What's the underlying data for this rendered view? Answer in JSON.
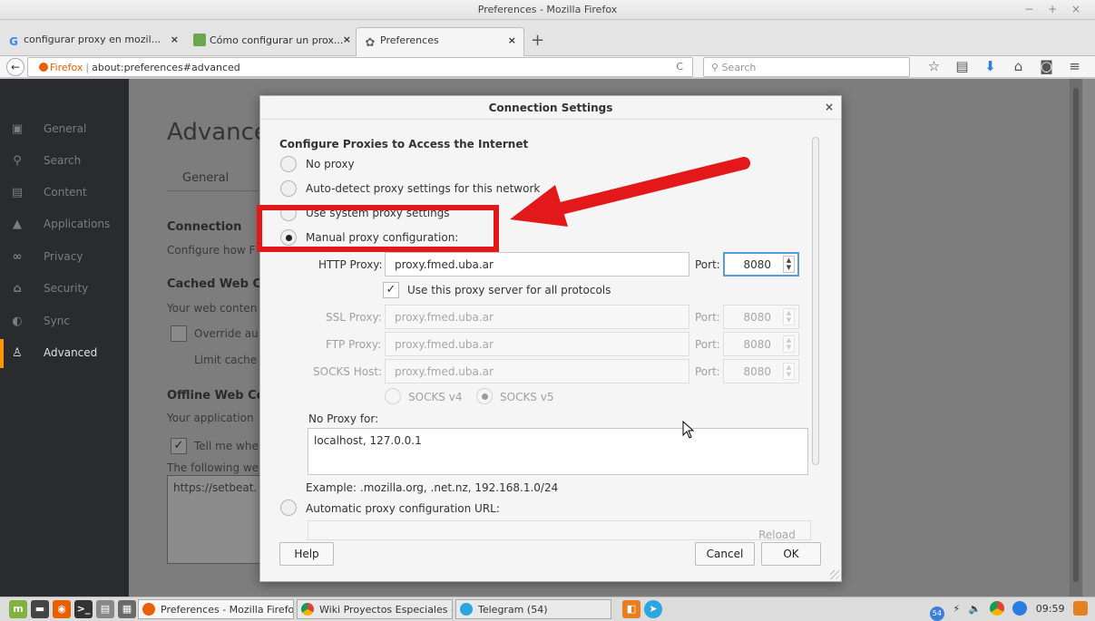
{
  "window": {
    "title": "Preferences - Mozilla Firefox",
    "controls": "− + ×"
  },
  "tabs": [
    {
      "label": "configurar proxy en mozil...",
      "close": "×",
      "icon": "google-icon"
    },
    {
      "label": "Cómo configurar un prox...",
      "close": "×",
      "icon": "site-favicon"
    },
    {
      "label": "Preferences",
      "close": "×",
      "icon": "gear-icon"
    }
  ],
  "new_tab_label": "+",
  "navbar": {
    "back": "←",
    "identity": "Firefox",
    "url": "about:preferences#advanced",
    "reload": "C",
    "search_placeholder": "Search",
    "icons": [
      "star-icon",
      "bookmarks-icon",
      "download-icon",
      "home-icon",
      "pocket-icon",
      "menu-icon"
    ]
  },
  "sidebar": {
    "items": [
      {
        "label": "General",
        "icon": "general-icon"
      },
      {
        "label": "Search",
        "icon": "search-icon"
      },
      {
        "label": "Content",
        "icon": "content-icon"
      },
      {
        "label": "Applications",
        "icon": "applications-icon"
      },
      {
        "label": "Privacy",
        "icon": "privacy-icon"
      },
      {
        "label": "Security",
        "icon": "security-icon"
      },
      {
        "label": "Sync",
        "icon": "sync-icon"
      },
      {
        "label": "Advanced",
        "icon": "advanced-icon",
        "active": true
      }
    ]
  },
  "prefs": {
    "title": "Advance",
    "subtab": "General",
    "connection_heading": "Connection",
    "connection_text": "Configure how F",
    "cached_heading": "Cached Web Co",
    "cached_text": "Your web conten",
    "override_label": "Override au",
    "limit_label": "Limit cache",
    "offline_heading": "Offline Web Co",
    "offline_text": "Your application",
    "tell_label": "Tell me whe",
    "following_text": "The following we",
    "site_entry": "https://setbeat."
  },
  "dialog": {
    "title": "Connection Settings",
    "close": "×",
    "section_heading": "Configure Proxies to Access the Internet",
    "options": {
      "no_proxy": "No proxy",
      "auto_detect": "Auto-detect proxy settings for this network",
      "system": "Use system proxy settings",
      "manual": "Manual proxy configuration:",
      "automatic_url": "Automatic proxy configuration URL:"
    },
    "selected_option": "manual",
    "http_label": "HTTP Proxy:",
    "http_value": "proxy.fmed.uba.ar",
    "http_port_label": "Port:",
    "http_port": "8080",
    "same_proxy_label": "Use this proxy server for all protocols",
    "same_proxy_checked": true,
    "ssl_label": "SSL Proxy:",
    "ssl_value": "proxy.fmed.uba.ar",
    "ssl_port_label": "Port:",
    "ssl_port": "8080",
    "ftp_label": "FTP Proxy:",
    "ftp_value": "proxy.fmed.uba.ar",
    "ftp_port_label": "Port:",
    "ftp_port": "8080",
    "socks_label": "SOCKS Host:",
    "socks_value": "proxy.fmed.uba.ar",
    "socks_port_label": "Port:",
    "socks_port": "8080",
    "socks_v4": "SOCKS v4",
    "socks_v5": "SOCKS v5",
    "no_proxy_label": "No Proxy for:",
    "no_proxy_value": "localhost, 127.0.0.1",
    "example_text": "Example: .mozilla.org, .net.nz, 192.168.1.0/24",
    "reload_label": "Reload",
    "help_label": "Help",
    "cancel_label": "Cancel",
    "ok_label": "OK"
  },
  "annotation": {
    "color": "#e3181a"
  },
  "taskbar": {
    "tasks": [
      {
        "label": "Preferences - Mozilla Firefox",
        "icon": "firefox-icon"
      },
      {
        "label": "Wiki Proyectos Especiales - p...",
        "icon": "chrome-icon"
      },
      {
        "label": "Telegram (54)",
        "icon": "telegram-icon"
      }
    ],
    "tray": {
      "badge": "54",
      "clock": "09:59"
    }
  }
}
